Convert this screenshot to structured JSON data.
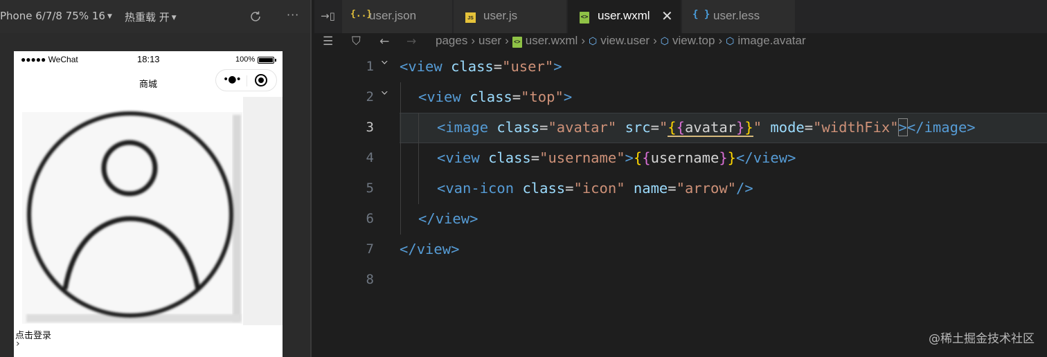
{
  "simulator": {
    "device_label": "Phone 6/7/8 75% 16",
    "hot_reload_label": "热重载 开",
    "phone": {
      "carrier": "●●●●● WeChat",
      "time": "18:13",
      "battery": "100%",
      "nav_title": "商城",
      "login_text": "点击登录",
      "arrow": "›"
    }
  },
  "editor": {
    "tabs": [
      {
        "label": "user.json",
        "icon": "{..}"
      },
      {
        "label": "user.js",
        "icon": "JS"
      },
      {
        "label": "user.wxml",
        "icon": "wxml",
        "active": true
      },
      {
        "label": "user.less",
        "icon": "{ }"
      }
    ],
    "breadcrumb": [
      "pages",
      "user",
      "user.wxml",
      "view.user",
      "view.top",
      "image.avatar"
    ],
    "current_line": 3,
    "line_numbers": [
      "1",
      "2",
      "3",
      "4",
      "5",
      "6",
      "7",
      "8"
    ],
    "code": {
      "l1": {
        "tag": "view",
        "attr": "class",
        "val": "\"user\""
      },
      "l2": {
        "tag": "view",
        "attr": "class",
        "val": "\"top\""
      },
      "l3": {
        "tag": "image",
        "attr1": "class",
        "val1": "\"avatar\"",
        "attr2": "src",
        "expr": "avatar",
        "attr3": "mode",
        "val3": "\"widthFix\"",
        "close": "image"
      },
      "l4": {
        "tag": "view",
        "attr": "class",
        "val": "\"username\"",
        "expr": "username",
        "close": "view"
      },
      "l5": {
        "tag": "van-icon",
        "attr1": "class",
        "val1": "\"icon\"",
        "attr2": "name",
        "val2": "\"arrow\""
      },
      "l6": {
        "close": "view"
      },
      "l7": {
        "close": "view"
      }
    }
  },
  "watermark": "@稀土掘金技术社区"
}
